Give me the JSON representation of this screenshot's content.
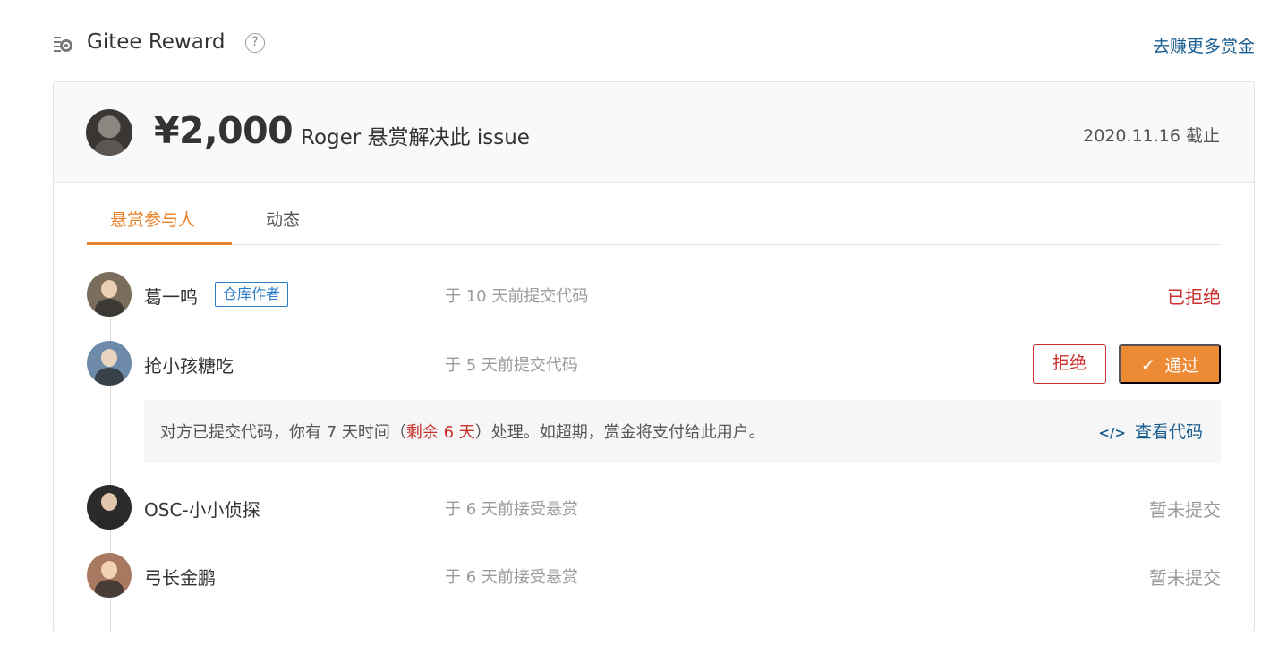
{
  "header": {
    "title": "Gitee Reward",
    "help": "?",
    "earn_more_link": "去赚更多赏金"
  },
  "reward": {
    "amount": "¥2,000",
    "description": "Roger 悬赏解决此 issue",
    "deadline": "2020.11.16 截止"
  },
  "tabs": [
    {
      "label": "悬赏参与人",
      "active": true
    },
    {
      "label": "动态",
      "active": false
    }
  ],
  "participants": [
    {
      "name": "葛一鸣",
      "badge": "仓库作者",
      "time": "于 10 天前提交代码",
      "status": "已拒绝"
    },
    {
      "name": "抢小孩糖吃",
      "time": "于 5 天前提交代码",
      "reject_label": "拒绝",
      "pass_label": "通过"
    },
    {
      "name": "OSC-小小侦探",
      "time": "于 6 天前接受悬赏",
      "status": "暂未提交"
    },
    {
      "name": "弓长金鹏",
      "time": "于 6 天前接受悬赏",
      "status": "暂未提交"
    }
  ],
  "notice": {
    "text_before": "对方已提交代码，你有 7 天时间（",
    "remaining": "剩余 6 天",
    "text_after": "）处理。如超期，赏金将支付给此用户。",
    "view_code_icon": "</>",
    "view_code": "查看代码"
  },
  "colors": {
    "accent": "#e8812a",
    "pass_button": "#ec8a35",
    "reject": "#c9302c",
    "link": "#1a5d8f",
    "badge": "#2a7dc9"
  }
}
